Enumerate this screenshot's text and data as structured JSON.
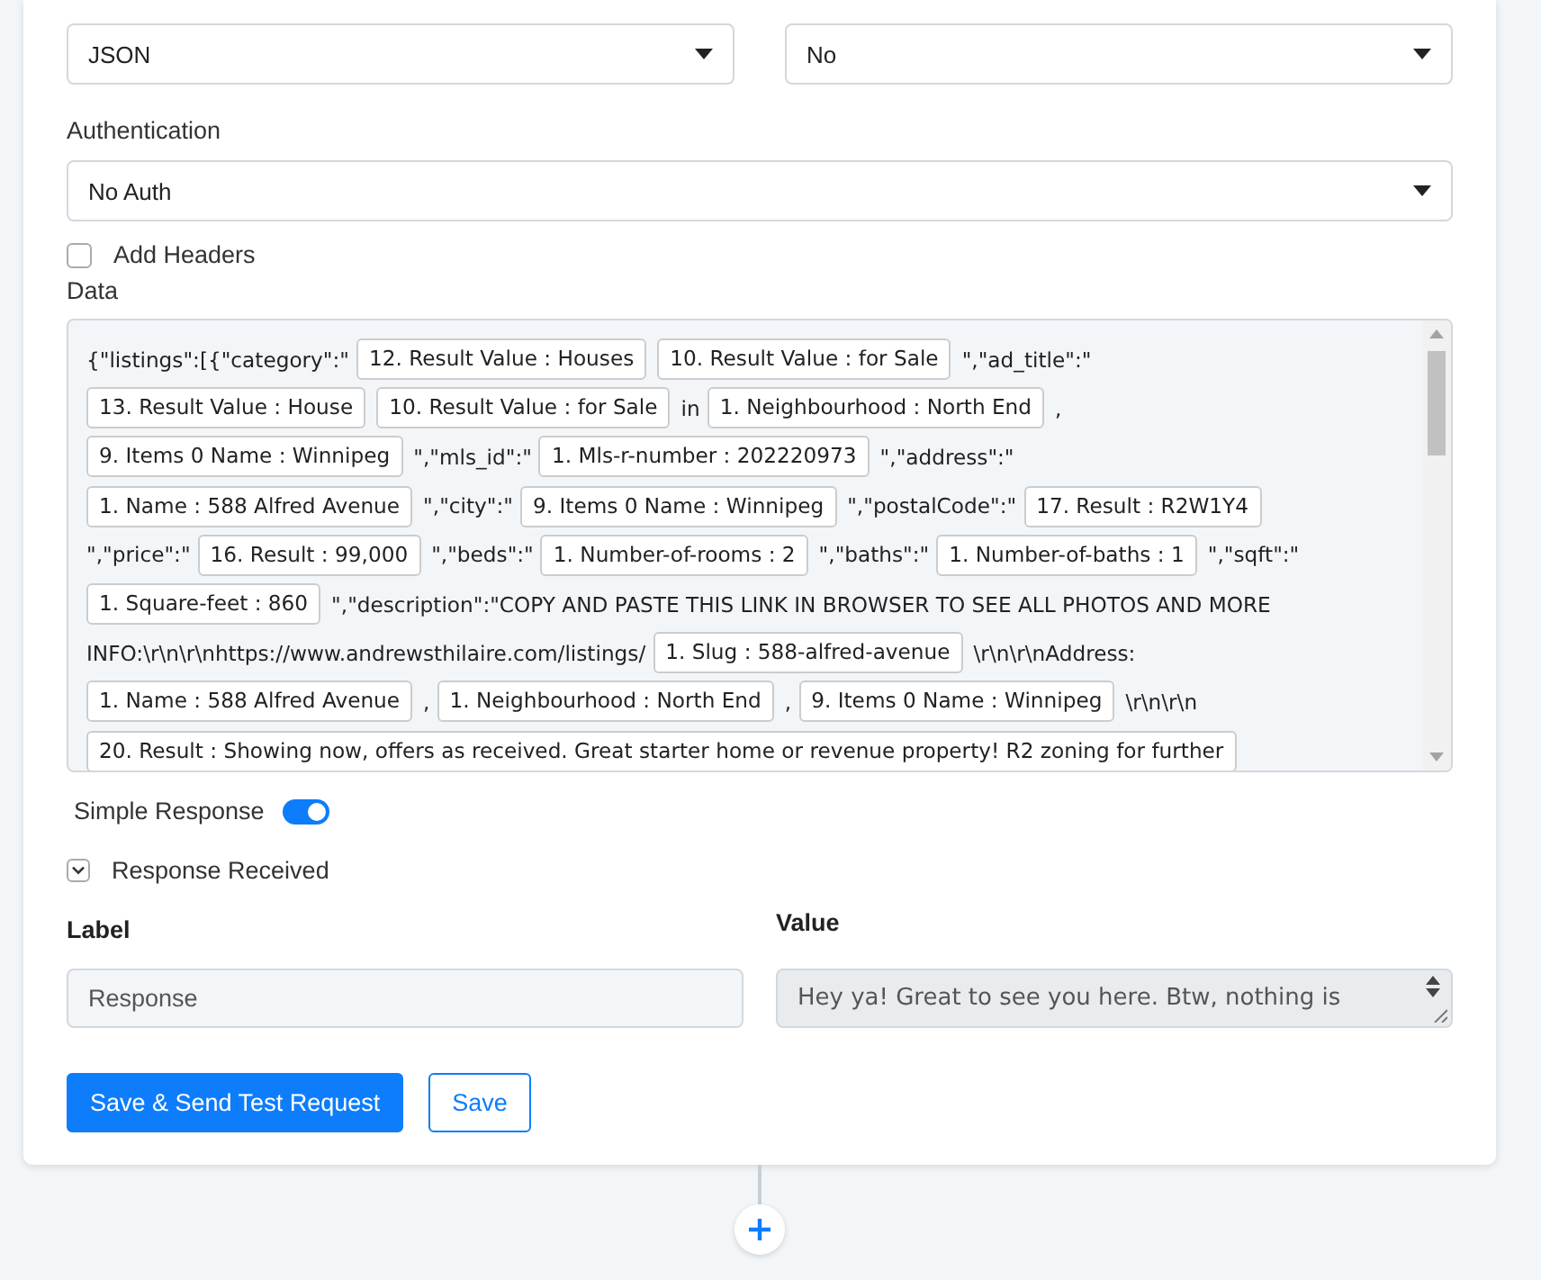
{
  "selects": [
    {
      "value": "JSON"
    },
    {
      "value": "No"
    }
  ],
  "authentication": {
    "label": "Authentication",
    "value": "No Auth"
  },
  "add_headers": {
    "label": "Add Headers",
    "checked": false
  },
  "data": {
    "label": "Data",
    "lines": [
      [
        {
          "kind": "text",
          "text": "{\"listings\":[{\"category\":\""
        },
        {
          "kind": "chip",
          "text": "12. Result Value : Houses"
        },
        {
          "kind": "chip",
          "text": "10. Result Value : for Sale"
        },
        {
          "kind": "text",
          "text": "\",\"ad_title\":\""
        }
      ],
      [
        {
          "kind": "chip",
          "text": "13. Result Value : House"
        },
        {
          "kind": "chip",
          "text": "10. Result Value : for Sale"
        },
        {
          "kind": "text",
          "text": "in"
        },
        {
          "kind": "chip",
          "text": "1. Neighbourhood : North End"
        },
        {
          "kind": "text",
          "text": ","
        }
      ],
      [
        {
          "kind": "chip",
          "text": "9. Items 0 Name : Winnipeg"
        },
        {
          "kind": "text",
          "text": "\",\"mls_id\":\""
        },
        {
          "kind": "chip",
          "text": "1. Mls-r-number : 202220973"
        },
        {
          "kind": "text",
          "text": "\",\"address\":\""
        }
      ],
      [
        {
          "kind": "chip",
          "text": "1. Name : 588 Alfred Avenue"
        },
        {
          "kind": "text",
          "text": "\",\"city\":\""
        },
        {
          "kind": "chip",
          "text": "9. Items 0 Name : Winnipeg"
        },
        {
          "kind": "text",
          "text": "\",\"postalCode\":\""
        },
        {
          "kind": "chip",
          "text": "17. Result : R2W1Y4"
        }
      ],
      [
        {
          "kind": "text",
          "text": "\",\"price\":\""
        },
        {
          "kind": "chip",
          "text": "16. Result : 99,000"
        },
        {
          "kind": "text",
          "text": "\",\"beds\":\""
        },
        {
          "kind": "chip",
          "text": "1. Number-of-rooms : 2"
        },
        {
          "kind": "text",
          "text": "\",\"baths\":\""
        },
        {
          "kind": "chip",
          "text": "1. Number-of-baths : 1"
        },
        {
          "kind": "text",
          "text": "\",\"sqft\":\""
        }
      ],
      [
        {
          "kind": "chip",
          "text": "1. Square-feet : 860"
        },
        {
          "kind": "text",
          "text": "\",\"description\":\"COPY AND PASTE THIS LINK IN BROWSER TO SEE ALL PHOTOS AND MORE"
        }
      ],
      [
        {
          "kind": "text",
          "text": "INFO:\\r\\n\\r\\nhttps://www.andrewsthilaire.com/listings/"
        },
        {
          "kind": "chip",
          "text": "1. Slug : 588-alfred-avenue"
        },
        {
          "kind": "text",
          "text": "\\r\\n\\r\\nAddress:"
        }
      ],
      [
        {
          "kind": "chip",
          "text": "1. Name : 588 Alfred Avenue"
        },
        {
          "kind": "text",
          "text": ","
        },
        {
          "kind": "chip",
          "text": "1. Neighbourhood : North End"
        },
        {
          "kind": "text",
          "text": ","
        },
        {
          "kind": "chip",
          "text": "9. Items 0 Name : Winnipeg"
        },
        {
          "kind": "text",
          "text": "\\r\\n\\r\\n"
        }
      ],
      [
        {
          "kind": "chip",
          "text": "20. Result : Showing now, offers as received. Great starter home or revenue property! R2 zoning for further"
        }
      ]
    ]
  },
  "simple_response": {
    "label": "Simple Response",
    "on": true
  },
  "response_received": {
    "label": "Response Received",
    "expanded": true
  },
  "mapping": {
    "columns": [
      "Label",
      "Value"
    ],
    "label_value": "Response",
    "value_text": "Hey ya! Great to see you here. Btw, nothing is"
  },
  "buttons": [
    {
      "label": "Save & Send Test Request",
      "kind": "primary"
    },
    {
      "label": "Save",
      "kind": "outline"
    }
  ]
}
